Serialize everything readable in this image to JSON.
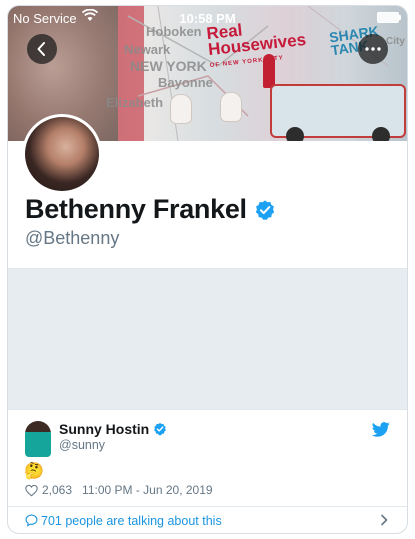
{
  "status_bar": {
    "carrier": "No Service",
    "time": "10:58 PM",
    "wifi_icon": "wifi-icon",
    "battery_icon": "battery-icon"
  },
  "header": {
    "back_icon": "chevron-left-icon",
    "more_icon": "more-horizontal-icon",
    "banner_text": {
      "hoboken": "Hoboken",
      "newark": "Newark",
      "new_york": "NEW YORK",
      "bayonne": "Bayonne",
      "elizabeth": "Elizabeth",
      "real_housewives_line1": "Real",
      "real_housewives_line2": "Housewives",
      "real_housewives_sub": "OF NEW YORK CITY",
      "shark_tank_line1": "SHARK",
      "shark_tank_line2": "TANK",
      "city": "City"
    }
  },
  "profile": {
    "name": "Bethenny Frankel",
    "handle": "@Bethenny",
    "verified": true
  },
  "embedded_tweet": {
    "author_name": "Sunny Hostin",
    "author_handle": "@sunny",
    "verified": true,
    "content": "🤔",
    "likes": "2,063",
    "timestamp": "11:00 PM - Jun 20, 2019"
  },
  "conversation": {
    "label": "701 people are talking about this"
  },
  "colors": {
    "twitter_blue": "#1da1f2",
    "link_blue": "#1b95e0",
    "secondary_text": "#657786",
    "primary_text": "#14171a",
    "placeholder_grey": "#e6ecf0"
  }
}
